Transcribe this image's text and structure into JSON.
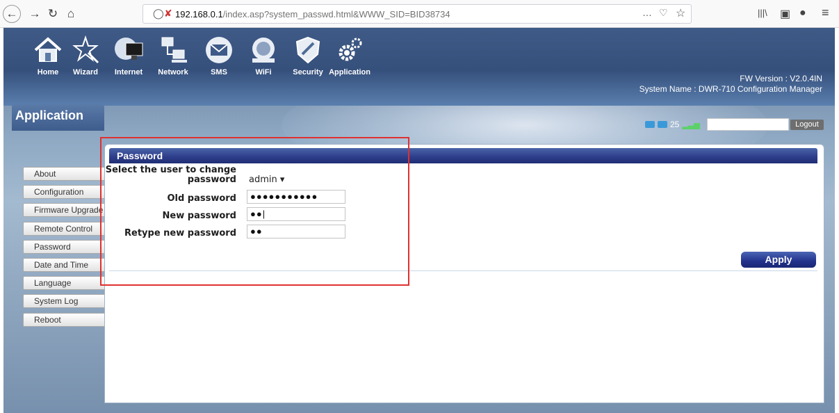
{
  "browser": {
    "url_host": "192.168.0.1",
    "url_path": "/index.asp?system_passwd.html&WWW_SID=BID38734",
    "back_glyph": "←",
    "forward_glyph": "→",
    "reload_glyph": "↻",
    "home_glyph": "⌂",
    "more_glyph": "…",
    "pocket_glyph": "♡",
    "star_glyph": "☆",
    "library_glyph": "|||\\",
    "sidebar_glyph": "▣",
    "account_glyph": "●",
    "menu_glyph": "≡"
  },
  "header": {
    "nav": [
      {
        "label": "Home",
        "icon": "home-icon"
      },
      {
        "label": "Wizard",
        "icon": "wizard-icon"
      },
      {
        "label": "Internet",
        "icon": "internet-icon"
      },
      {
        "label": "Network",
        "icon": "network-icon"
      },
      {
        "label": "SMS",
        "icon": "sms-icon"
      },
      {
        "label": "WiFi",
        "icon": "wifi-icon"
      },
      {
        "label": "Security",
        "icon": "security-icon"
      },
      {
        "label": "Application",
        "icon": "application-icon"
      }
    ],
    "fw_version": "FW Version : V2.0.4IN",
    "system_name": "System Name : DWR-710 Configuration Manager",
    "section_title": "Application",
    "sms_count": "25",
    "logout_label": "Logout",
    "username": ""
  },
  "sidebar": {
    "items": [
      {
        "label": "About"
      },
      {
        "label": "Configuration"
      },
      {
        "label": "Firmware Upgrade"
      },
      {
        "label": "Remote Control"
      },
      {
        "label": "Password"
      },
      {
        "label": "Date and Time"
      },
      {
        "label": "Language"
      },
      {
        "label": "System Log"
      },
      {
        "label": "Reboot"
      }
    ]
  },
  "panel": {
    "title": "Password",
    "user_label": "Select the user to change password",
    "user_value": "admin ▾",
    "old_label": "Old password",
    "old_value": "●●●●●●●●●●●",
    "new_label": "New password",
    "new_value": "●●|",
    "retype_label": "Retype new password",
    "retype_value": "●●",
    "apply_label": "Apply"
  },
  "colors": {
    "accent_blue": "#2f3f8c",
    "highlight_red": "#e03030"
  }
}
